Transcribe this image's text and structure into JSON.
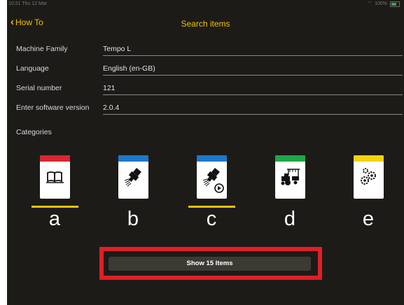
{
  "status": {
    "left": "10:21  Thu 12 Mar",
    "right": "100%"
  },
  "nav": {
    "back_label": "How To",
    "title": "Search items"
  },
  "form": [
    {
      "label": "Machine Family",
      "value": "Tempo L"
    },
    {
      "label": "Language",
      "value": "English (en-GB)"
    },
    {
      "label": "Serial number",
      "value": "121"
    },
    {
      "label": "Enter software version",
      "value": "2.0.4"
    }
  ],
  "categories_heading": "Categories",
  "categories": [
    {
      "letter": "a",
      "band_color": "#d9262e",
      "icon": "book-icon",
      "selected": true
    },
    {
      "letter": "b",
      "band_color": "#1e78c8",
      "icon": "sprayer-nozzle-icon",
      "selected": false
    },
    {
      "letter": "c",
      "band_color": "#1e78c8",
      "icon": "sprayer-video-icon",
      "selected": true
    },
    {
      "letter": "d",
      "band_color": "#1fa647",
      "icon": "tractor-planter-icon",
      "selected": false
    },
    {
      "letter": "e",
      "band_color": "#f7d20c",
      "icon": "gears-icon",
      "selected": false
    }
  ],
  "show_button": {
    "label": "Show 15 Items"
  },
  "colors": {
    "accent": "#f2c200",
    "background": "#1d1b18",
    "highlight": "#e01f26"
  }
}
